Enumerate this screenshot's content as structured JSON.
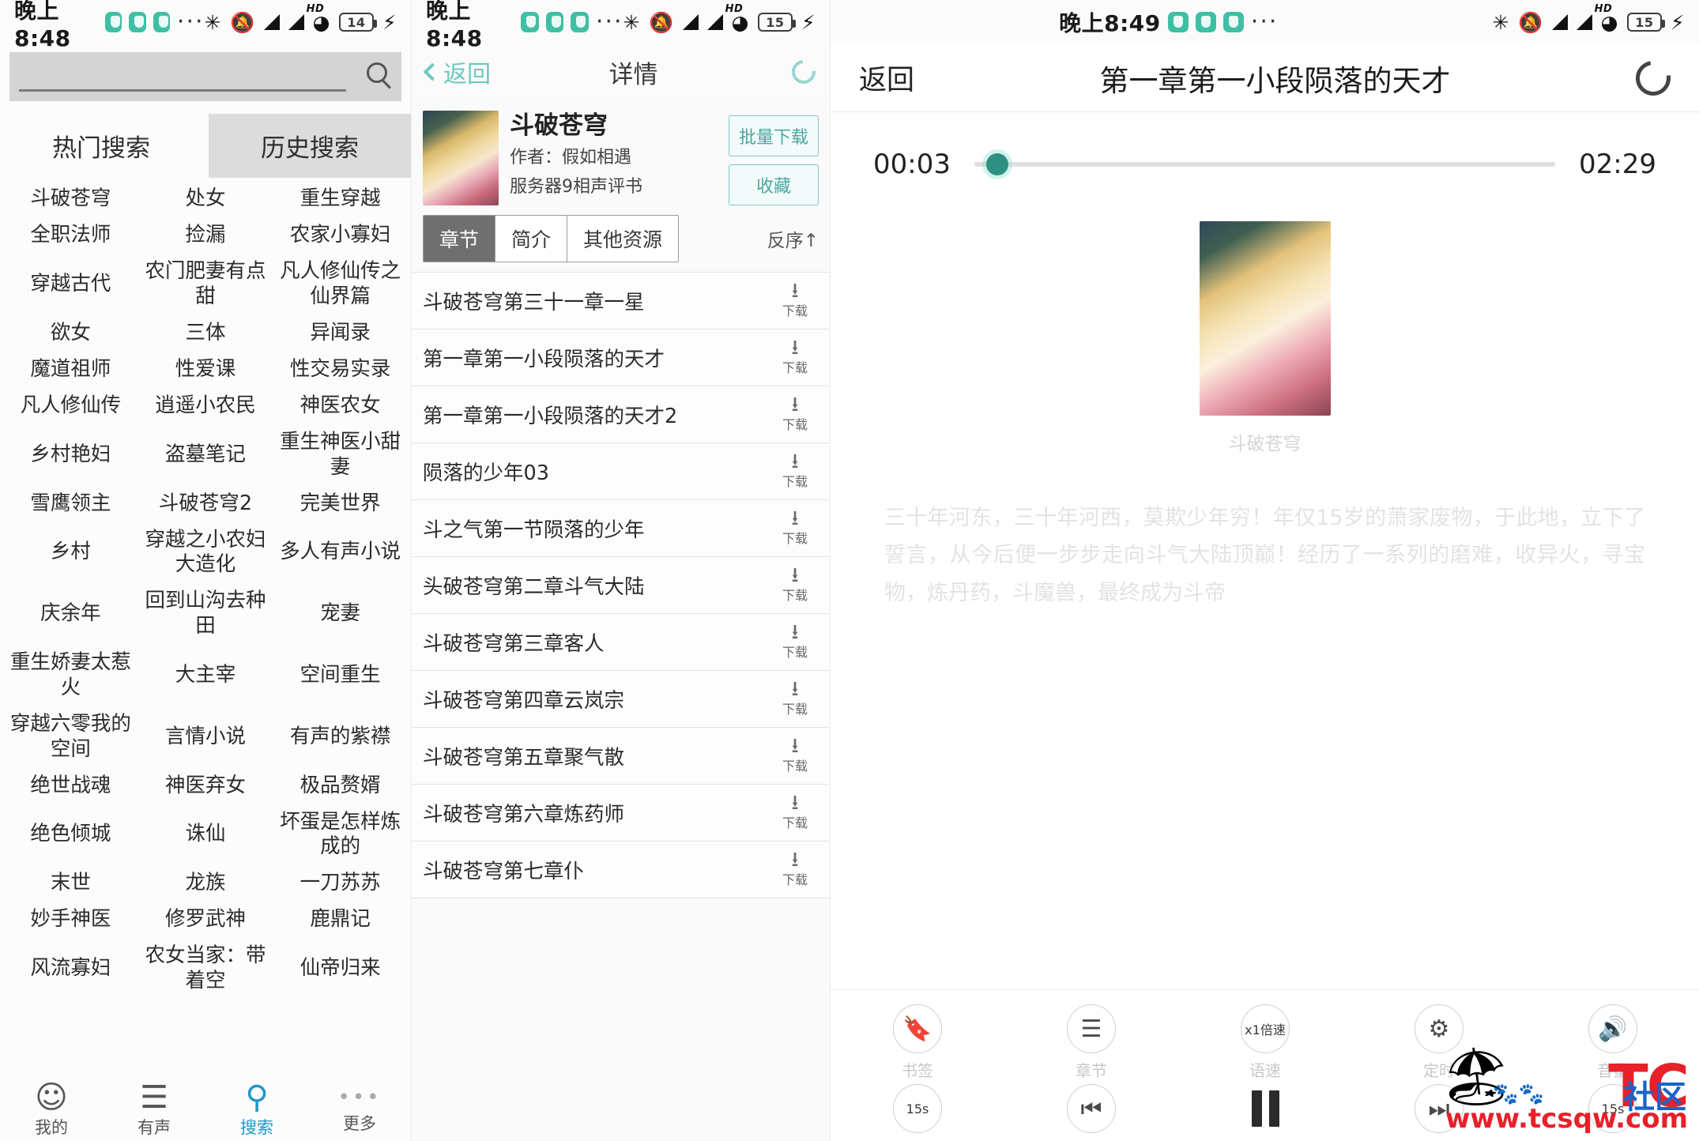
{
  "panel1": {
    "statusbar": {
      "time": "晚上8:48",
      "battery": "14",
      "dots": "···"
    },
    "search": {
      "placeholder": "",
      "value": "",
      "icon": "search-icon"
    },
    "tabs": [
      {
        "label": "热门搜索",
        "active": true
      },
      {
        "label": "历史搜索",
        "active": false
      }
    ],
    "hot_keywords": [
      "斗破苍穹",
      "处女",
      "重生穿越",
      "全职法师",
      "捡漏",
      "农家小寡妇",
      "穿越古代",
      "农门肥妻有点甜",
      "凡人修仙传之仙界篇",
      "欲女",
      "三体",
      "异闻录",
      "魔道祖师",
      "性爱课",
      "性交易实录",
      "凡人修仙传",
      "逍遥小农民",
      "神医农女",
      "乡村艳妇",
      "盗墓笔记",
      "重生神医小甜妻",
      "雪鹰领主",
      "斗破苍穹2",
      "完美世界",
      "乡村",
      "穿越之小农妇大造化",
      "多人有声小说",
      "庆余年",
      "回到山沟去种田",
      "宠妻",
      "重生娇妻太惹火",
      "大主宰",
      "空间重生",
      "穿越六零我的空间",
      "言情小说",
      "有声的紫襟",
      "绝世战魂",
      "神医弃女",
      "极品赘婿",
      "绝色倾城",
      "诛仙",
      "坏蛋是怎样炼成的",
      "末世",
      "龙族",
      "一刀苏苏",
      "妙手神医",
      "修罗武神",
      "鹿鼎记",
      "风流寡妇",
      "农女当家：带着空",
      "仙帝归来"
    ],
    "bottom_nav": [
      {
        "label": "我的",
        "icon": "person-icon",
        "active": false
      },
      {
        "label": "有声",
        "icon": "list-icon",
        "active": false
      },
      {
        "label": "搜索",
        "icon": "search-icon",
        "active": true
      },
      {
        "label": "更多",
        "icon": "more-dots-icon",
        "active": false
      }
    ]
  },
  "panel2": {
    "statusbar": {
      "time": "晚上8:48",
      "battery": "15",
      "dots": "···"
    },
    "navbar": {
      "back": "返回",
      "title": "详情",
      "refresh_icon": "refresh-icon"
    },
    "book": {
      "title": "斗破苍穹",
      "author": "作者：假如相遇",
      "server": "服务器9相声评书",
      "cover_icon": "book-cover"
    },
    "actions": [
      {
        "label": "批量下载"
      },
      {
        "label": "收藏"
      }
    ],
    "tabs": [
      {
        "label": "章节",
        "active": true
      },
      {
        "label": "简介",
        "active": false
      },
      {
        "label": "其他资源",
        "active": false
      }
    ],
    "sort": "反序↑",
    "download_label": "下载",
    "chapters": [
      "斗破苍穹第三十一章一星",
      "第一章第一小段陨落的天才",
      "第一章第一小段陨落的天才2",
      "陨落的少年03",
      "斗之气第一节陨落的少年",
      "头破苍穹第二章斗气大陆",
      "斗破苍穹第三章客人",
      "斗破苍穹第四章云岚宗",
      "斗破苍穹第五章聚气散",
      "斗破苍穹第六章炼药师",
      "斗破苍穹第七章仆"
    ]
  },
  "panel3": {
    "statusbar": {
      "time": "晚上8:49",
      "battery": "15",
      "dots": "···"
    },
    "navbar": {
      "back": "返回",
      "title": "第一章第一小段陨落的天才",
      "refresh_icon": "refresh-icon"
    },
    "player": {
      "current_time": "00:03",
      "total_time": "02:29",
      "progress_percent": 2,
      "cover_caption": "斗破苍穹",
      "description": "三十年河东，三十年河西，莫欺少年穷！年仅15岁的萧家废物，于此地，立下了誓言，从今后便一步步走向斗气大陆顶巅！经历了一系列的磨难，收异火，寻宝物，炼丹药，斗魔兽，最终成为斗帝"
    },
    "controls_top": [
      {
        "label": "书签",
        "icon": "bookmark-icon"
      },
      {
        "label": "章节",
        "icon": "list-icon"
      },
      {
        "label": "语速",
        "icon": "speed-icon",
        "value": "x1倍速"
      },
      {
        "label": "定时",
        "icon": "timer-icon"
      },
      {
        "label": "音量",
        "icon": "volume-icon"
      }
    ],
    "controls_bottom": [
      {
        "label": "后退15秒",
        "icon": "rewind-15-icon",
        "value": "15s"
      },
      {
        "label": "上一集",
        "icon": "previous-icon"
      },
      {
        "label": "暂停",
        "icon": "pause-icon"
      },
      {
        "label": "下一集",
        "icon": "next-icon"
      },
      {
        "label": "前进15秒",
        "icon": "forward-15-icon",
        "value": "15s"
      }
    ]
  },
  "watermark": {
    "brand": "TC",
    "suffix": "社区",
    "url": "www.tcsqw.com"
  },
  "colors": {
    "accent_teal": "#3fbfa4",
    "link_teal": "#6fc9c0",
    "active_blue": "#2196c9",
    "watermark_red": "#e8202a",
    "watermark_blue": "#1b63c8"
  }
}
